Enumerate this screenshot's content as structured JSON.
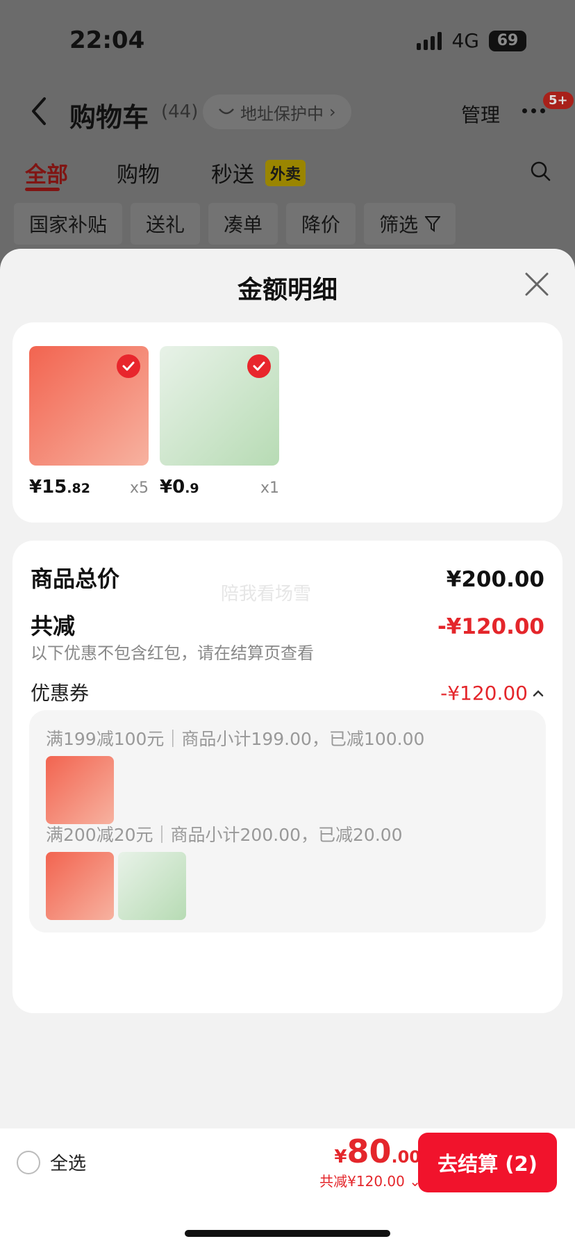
{
  "status_bar": {
    "time": "22:04",
    "network": "4G",
    "battery": "69"
  },
  "nav": {
    "title": "购物车",
    "count": "(44)",
    "address_chip": "地址保护中",
    "manage": "管理",
    "badge": "5+"
  },
  "tabs": [
    {
      "label": "全部",
      "active": true
    },
    {
      "label": "购物",
      "active": false
    },
    {
      "label": "秒送",
      "active": false,
      "tag": "外卖"
    }
  ],
  "filters": [
    "国家补贴",
    "送礼",
    "凑单",
    "降价",
    "筛选"
  ],
  "sheet": {
    "title": "金额明细",
    "products": [
      {
        "price_int": "¥15",
        "price_dec": ".82",
        "qty": "x5"
      },
      {
        "price_int": "¥0",
        "price_dec": ".9",
        "qty": "x1"
      }
    ],
    "breakdown": {
      "total_label": "商品总价",
      "total_value": "¥200.00",
      "watermark": "陪我看场雪",
      "discount_label": "共减",
      "discount_value": "-¥120.00",
      "note": "以下优惠不包含红包，请在结算页查看",
      "coupon_label": "优惠券",
      "coupon_value": "-¥120.00",
      "coupon_rules": [
        "满199减100元｜商品小计199.00，已减100.00",
        "满200减20元｜商品小计200.00，已减20.00"
      ]
    }
  },
  "bottom_bar": {
    "select_all": "全选",
    "total_yen": "¥",
    "total_int": "80",
    "total_dec": ".00",
    "total_saved": "共减¥120.00",
    "checkout": "去结算 (2)"
  },
  "colors": {
    "accent_red": "#e4262b",
    "checkout_red": "#f1132c"
  }
}
